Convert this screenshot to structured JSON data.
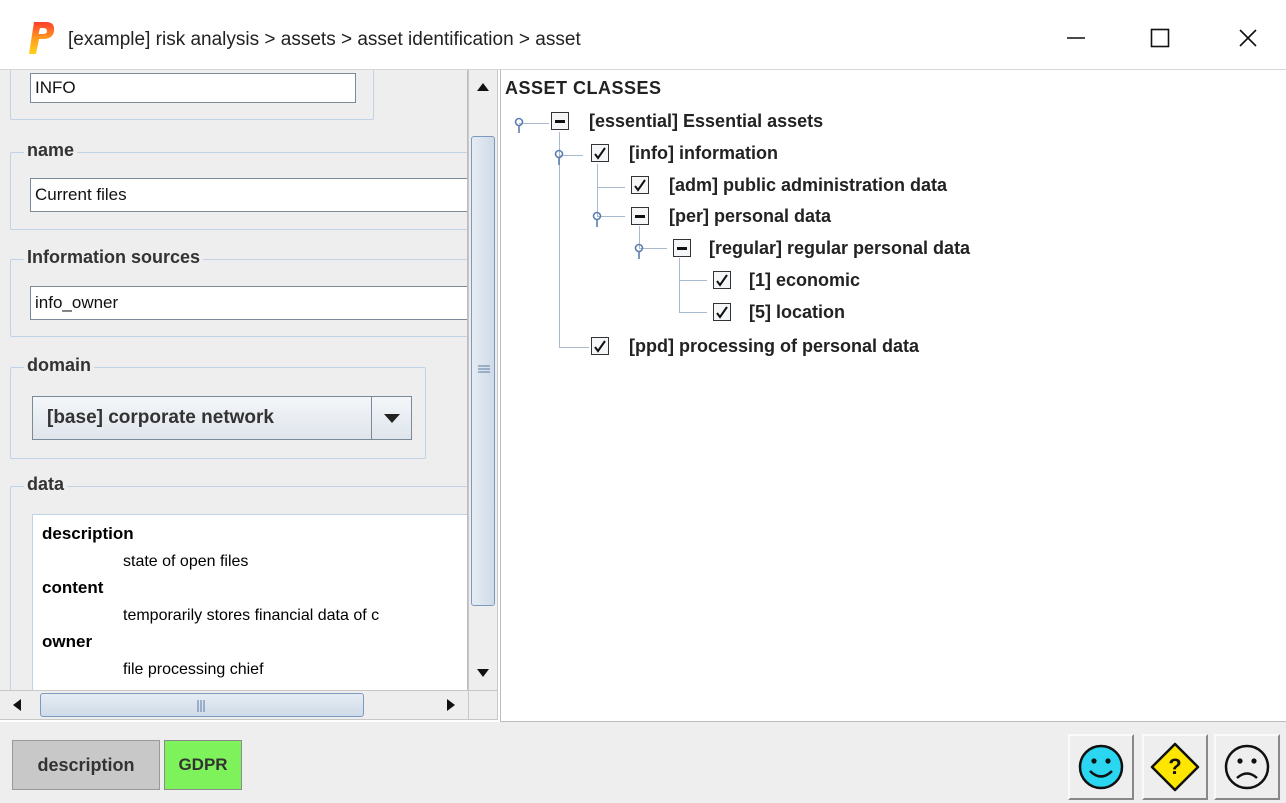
{
  "window": {
    "title": "[example] risk analysis > assets > asset identification > asset",
    "logo_letter": "P",
    "controls": [
      "minimize-icon",
      "maximize-icon",
      "close-icon"
    ]
  },
  "form": {
    "code_value": "INFO",
    "name_label": "name",
    "name_value": "Current files",
    "sources_label": "Information sources",
    "sources_value": "info_owner",
    "domain_label": "domain",
    "domain_value": "[base] corporate network",
    "data_label": "data",
    "data_entries": [
      {
        "key": "description",
        "value": "state of open files"
      },
      {
        "key": "content",
        "value": "temporarily stores financial data of c"
      },
      {
        "key": "owner",
        "value": "file processing chief"
      }
    ]
  },
  "tree": {
    "root": "ASSET CLASSES",
    "nodes": [
      {
        "label": "[essential] Essential assets",
        "state": "partial"
      },
      {
        "label": "[info] information",
        "state": "checked"
      },
      {
        "label": "[adm] public administration data",
        "state": "checked"
      },
      {
        "label": "[per] personal data",
        "state": "partial"
      },
      {
        "label": "[regular] regular personal data",
        "state": "partial"
      },
      {
        "label": "[1] economic",
        "state": "checked"
      },
      {
        "label": "[5] location",
        "state": "checked"
      },
      {
        "label": "[ppd] processing of personal data",
        "state": "checked"
      }
    ]
  },
  "bottom": {
    "description_button": "description",
    "gdpr_button": "GDPR",
    "gdpr_color": "#7ef25a",
    "action_icons": [
      "happy-face-icon",
      "help-diamond-icon",
      "sad-face-icon"
    ]
  },
  "colors": {
    "face_cyan": "#2ad6f0",
    "help_yellow": "#ffe600",
    "scroll_thumb_border": "#7d99bd"
  }
}
